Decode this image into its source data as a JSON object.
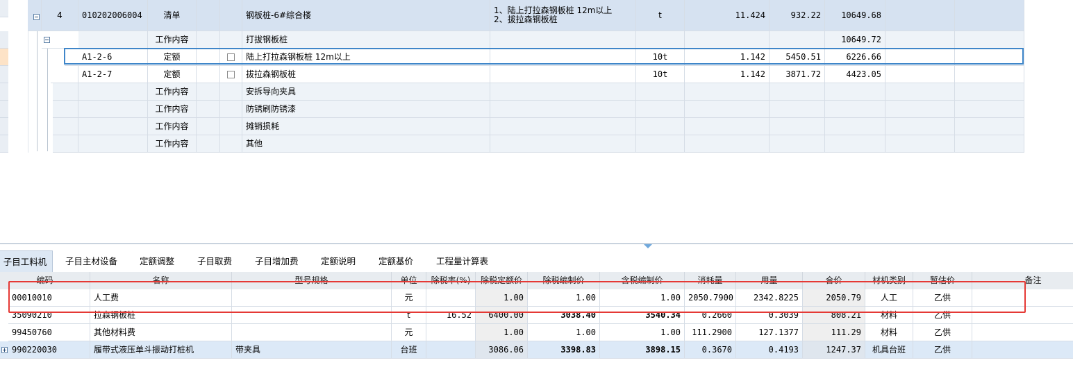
{
  "top_grid": {
    "rows": [
      {
        "kind": "qingdan",
        "index": "4",
        "code": "010202006004",
        "type": "清单",
        "name": "钢板桩-6#综合楼",
        "feature_line1": "1、陆上打拉森钢板桩 12m以上",
        "feature_line2": "2、拔拉森钢板桩",
        "unit": "t",
        "qty": "11.424",
        "price": "932.22",
        "total": "10649.68"
      },
      {
        "kind": "work",
        "type": "工作内容",
        "name": "打拔钢板桩",
        "total": "10649.72"
      },
      {
        "kind": "dinge",
        "code": "A1-2-6",
        "type": "定额",
        "name": "陆上打拉森钢板桩 12m以上",
        "unit": "10t",
        "qty": "1.142",
        "price": "5450.51",
        "total": "6226.66"
      },
      {
        "kind": "dinge",
        "code": "A1-2-7",
        "type": "定额",
        "name": "拔拉森钢板桩",
        "unit": "10t",
        "qty": "1.142",
        "price": "3871.72",
        "total": "4423.05"
      },
      {
        "kind": "work",
        "type": "工作内容",
        "name": "安拆导向夹具"
      },
      {
        "kind": "work",
        "type": "工作内容",
        "name": "防锈刷防锈漆"
      },
      {
        "kind": "work",
        "type": "工作内容",
        "name": "摊销损耗"
      },
      {
        "kind": "work",
        "type": "工作内容",
        "name": "其他"
      }
    ]
  },
  "tabs": [
    "子目工料机",
    "子目主材设备",
    "定额调整",
    "子目取费",
    "子目增加费",
    "定额说明",
    "定额基价",
    "工程量计算表"
  ],
  "bottom_grid": {
    "headers": [
      "编码",
      "名称",
      "型号规格",
      "单位",
      "除税率(%)",
      "除税定额价",
      "除税编制价",
      "含税编制价",
      "消耗量",
      "用量",
      "合价",
      "材机类别",
      "暂估价",
      "备注"
    ],
    "rows": [
      {
        "code": "00010010",
        "name": "人工费",
        "spec": "",
        "unit": "元",
        "tax_rate": "",
        "quota_price": "1.00",
        "net_price": "1.00",
        "gross_price": "1.00",
        "consumption": "2050.7900",
        "usage": "2342.8225",
        "amount": "2050.79",
        "category": "人工",
        "provisional": "乙供",
        "note": ""
      },
      {
        "code": "35090210",
        "name": "拉森钢板桩",
        "spec": "",
        "unit": "t",
        "tax_rate": "16.52",
        "quota_price": "6400.00",
        "net_price": "3038.40",
        "gross_price": "3540.34",
        "consumption": "0.2660",
        "usage": "0.3039",
        "amount": "808.21",
        "category": "材料",
        "provisional": "乙供",
        "note": ""
      },
      {
        "code": "99450760",
        "name": "其他材料费",
        "spec": "",
        "unit": "元",
        "tax_rate": "",
        "quota_price": "1.00",
        "net_price": "1.00",
        "gross_price": "1.00",
        "consumption": "111.2900",
        "usage": "127.1377",
        "amount": "111.29",
        "category": "材料",
        "provisional": "乙供",
        "note": ""
      },
      {
        "code": "990220030",
        "name": "履带式液压单斗振动打桩机",
        "spec": "带夹具",
        "unit": "台班",
        "tax_rate": "",
        "quota_price": "3086.06",
        "net_price": "3398.83",
        "gross_price": "3898.15",
        "consumption": "0.3670",
        "usage": "0.4193",
        "amount": "1247.37",
        "category": "机具台班",
        "provisional": "乙供",
        "note": ""
      }
    ]
  },
  "colors": {
    "highlight_box": "#e53935",
    "selection": "#3f86c9",
    "qingdan_row": "#d6e2f1",
    "work_row": "#eef3f8"
  }
}
